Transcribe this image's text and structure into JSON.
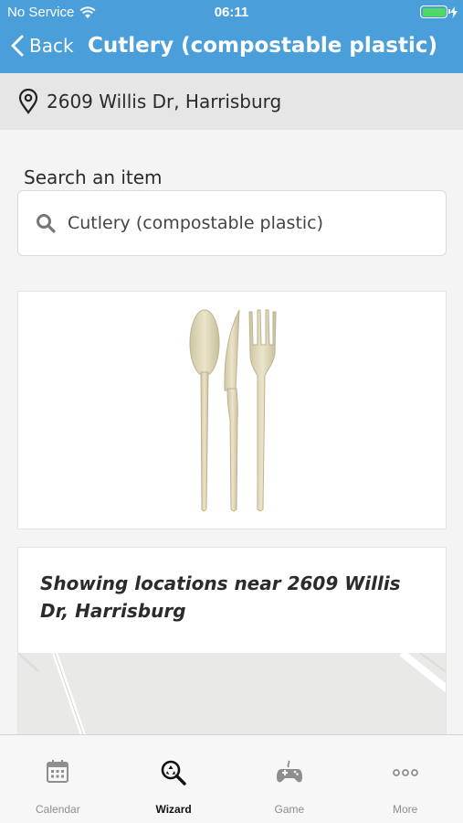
{
  "status_bar": {
    "carrier": "No Service",
    "time": "06:11"
  },
  "nav": {
    "back_label": "Back",
    "title": "Cutlery (compostable plastic)"
  },
  "address": {
    "text": "2609 Willis Dr, Harrisburg"
  },
  "search": {
    "label": "Search an item",
    "value": "Cutlery (compostable plastic)"
  },
  "locations": {
    "heading": "Showing locations near 2609 Willis Dr, Harrisburg"
  },
  "tabs": [
    {
      "label": "Calendar",
      "icon": "calendar-icon",
      "active": false
    },
    {
      "label": "Wizard",
      "icon": "wizard-search-icon",
      "active": true
    },
    {
      "label": "Game",
      "icon": "gamepad-icon",
      "active": false
    },
    {
      "label": "More",
      "icon": "more-icon",
      "active": false
    }
  ],
  "colors": {
    "header": "#4a9fda",
    "battery": "#4cd964",
    "background": "#f4f4f4"
  }
}
